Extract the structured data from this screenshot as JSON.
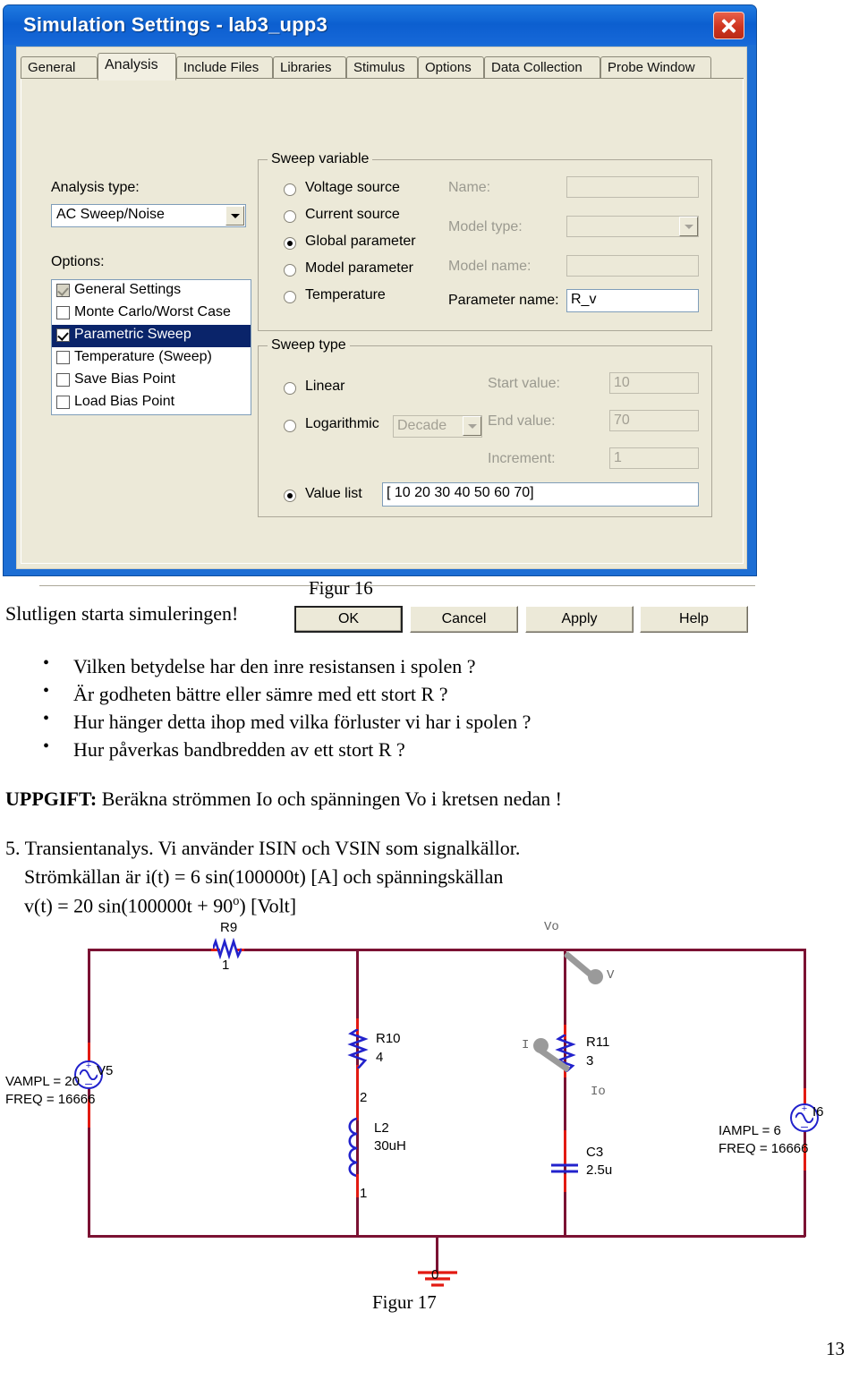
{
  "dialog": {
    "title": "Simulation Settings - lab3_upp3",
    "close_icon": "close-icon",
    "tabs": [
      {
        "label": "General",
        "selected": false
      },
      {
        "label": "Analysis",
        "selected": true
      },
      {
        "label": "Include Files",
        "selected": false
      },
      {
        "label": "Libraries",
        "selected": false
      },
      {
        "label": "Stimulus",
        "selected": false
      },
      {
        "label": "Options",
        "selected": false
      },
      {
        "label": "Data Collection",
        "selected": false
      },
      {
        "label": "Probe Window",
        "selected": false
      }
    ],
    "analysis_type_label": "Analysis type:",
    "analysis_type_value": "AC Sweep/Noise",
    "options_label": "Options:",
    "options": [
      {
        "label": "General Settings",
        "checked": true,
        "disabled": true,
        "selected": false
      },
      {
        "label": "Monte Carlo/Worst Case",
        "checked": false,
        "disabled": false,
        "selected": false
      },
      {
        "label": "Parametric Sweep",
        "checked": true,
        "disabled": false,
        "selected": true
      },
      {
        "label": "Temperature (Sweep)",
        "checked": false,
        "disabled": false,
        "selected": false
      },
      {
        "label": "Save Bias Point",
        "checked": false,
        "disabled": false,
        "selected": false
      },
      {
        "label": "Load Bias Point",
        "checked": false,
        "disabled": false,
        "selected": false
      }
    ],
    "sweep_variable": {
      "title": "Sweep variable",
      "radios": [
        {
          "label": "Voltage source",
          "selected": false
        },
        {
          "label": "Current source",
          "selected": false
        },
        {
          "label": "Global parameter",
          "selected": true
        },
        {
          "label": "Model parameter",
          "selected": false
        },
        {
          "label": "Temperature",
          "selected": false
        }
      ],
      "name_label": "Name:",
      "name_value": "",
      "model_type_label": "Model type:",
      "model_type_value": "",
      "model_name_label": "Model name:",
      "model_name_value": "",
      "parameter_name_label": "Parameter name:",
      "parameter_name_value": "R_v"
    },
    "sweep_type": {
      "title": "Sweep type",
      "radios": [
        {
          "label": "Linear",
          "selected": false
        },
        {
          "label": "Logarithmic",
          "selected": false
        },
        {
          "label": "Value list",
          "selected": true
        }
      ],
      "log_scale_value": "Decade",
      "start_value_label": "Start value:",
      "start_value": "10",
      "end_value_label": "End value:",
      "end_value": "70",
      "increment_label": "Increment:",
      "increment_value": "1",
      "value_list": "[ 10 20 30 40 50 60 70]"
    },
    "buttons": {
      "ok": "OK",
      "cancel": "Cancel",
      "apply": "Apply",
      "help": "Help"
    }
  },
  "document": {
    "figure16_caption": "Figur 16",
    "intro": "Slutligen starta simuleringen!",
    "bullets": [
      "Vilken betydelse har den inre resistansen i spolen ?",
      "Är godheten bättre eller sämre med ett stort R ?",
      "Hur hänger detta ihop med vilka förluster vi har i spolen ?",
      "Hur påverkas bandbredden av ett stort R ?"
    ],
    "task_bold": "UPPGIFT:",
    "task_rest": " Beräkna strömmen Io och spänningen Vo i kretsen nedan !",
    "section5_line1": "5. Transientanalys. Vi använder ISIN och VSIN som signalkällor.",
    "section5_line2": "Strömkällan är i(t) = 6 sin(100000t) [A] och spänningskällan",
    "section5_line3_pre": "v(t) = 20 sin(100000t + 90",
    "section5_line3_sup": "o",
    "section5_line3_post": ") [Volt]",
    "figure17_caption": "Figur 17",
    "page_number": "13"
  },
  "circuit": {
    "components": {
      "r9_name": "R9",
      "r9_value": "1",
      "r10_name": "R10",
      "r10_value": "4",
      "r11_name": "R11",
      "r11_value": "3",
      "l2_name": "L2",
      "l2_value": "30uH",
      "c3_name": "C3",
      "c3_value": "2.5u",
      "v5_name": "V5",
      "v5_vampl": "VAMPL = 20",
      "v5_freq": "FREQ = 16666",
      "i6_name": "I6",
      "i6_iampl": "IAMPL = 6",
      "i6_freq": "FREQ = 16666",
      "node_2": "2",
      "node_1": "1",
      "ground": "0"
    },
    "markers": {
      "vo_net": "Vo",
      "io_net": "Io",
      "v_probe": "V",
      "i_probe": "I"
    }
  },
  "colors": {
    "titlebar_blue": "#0c5fd0",
    "dialog_face": "#ece9d8",
    "selection_blue": "#0a246a",
    "wire_dark_red": "#7b1233",
    "wire_red": "#e21a12",
    "component_blue": "#2222cc",
    "probe_gray": "#9a9a9a"
  }
}
